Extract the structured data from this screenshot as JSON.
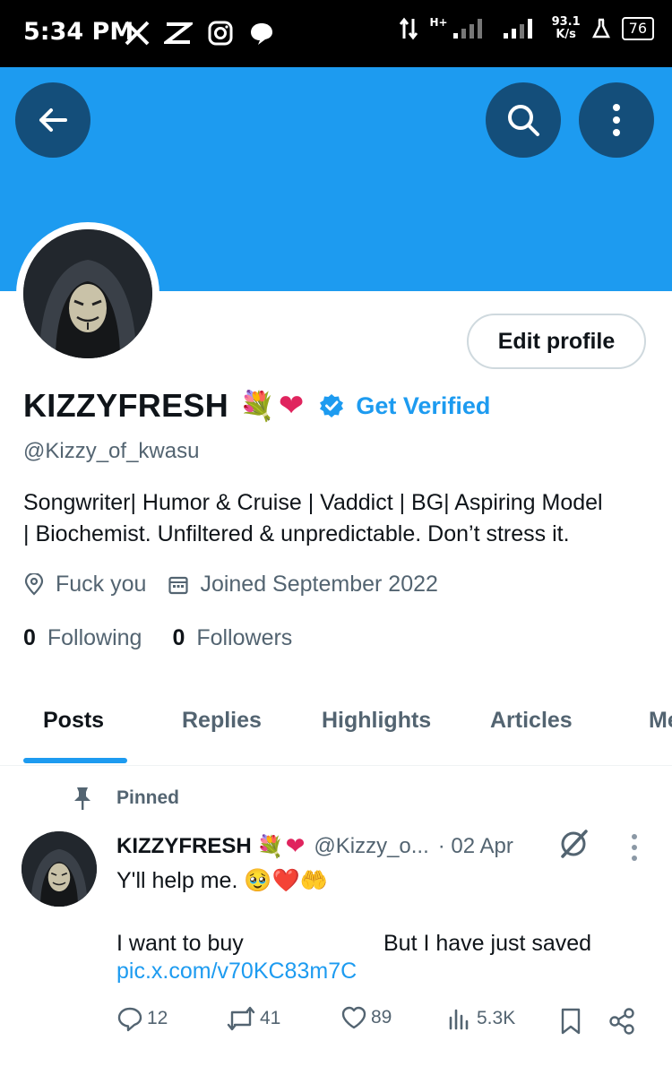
{
  "status_bar": {
    "time": "5:34 PM",
    "network_label": "H+",
    "speed_value": "93.1",
    "speed_unit": "K/s",
    "battery": "76"
  },
  "header": {
    "back_icon": "arrow-left-icon",
    "search_icon": "search-icon",
    "more_icon": "more-vertical-icon",
    "banner_color": "#1d9bf0"
  },
  "profile": {
    "edit_label": "Edit profile",
    "name": "KIZZYFRESH",
    "name_emoji_flowers": "💐",
    "name_emoji_heart": "❤",
    "verified_label": "Get Verified",
    "handle": "@Kizzy_of_kwasu",
    "bio_line1": "Songwriter| Humor & Cruise | Vaddict | BG| Aspiring Model",
    "bio_line2": "| Biochemist.  Unfiltered & unpredictable. Don’t stress it.",
    "location": "Fuck you",
    "joined": "Joined September 2022",
    "following_count": "0",
    "following_label": "Following",
    "followers_count": "0",
    "followers_label": "Followers"
  },
  "tabs": [
    {
      "label": "Posts"
    },
    {
      "label": "Replies"
    },
    {
      "label": "Highlights"
    },
    {
      "label": "Articles"
    },
    {
      "label": "Me"
    }
  ],
  "pinned_label": "Pinned",
  "tweet": {
    "name": "KIZZYFRESH",
    "name_emoji_flowers": "💐",
    "name_emoji_heart": "❤",
    "handle": "@Kizzy_o...",
    "date": "· 02 Apr",
    "line1": "Y'll help me. 🥹❤️🤲",
    "line2_left": "I want to buy",
    "line2_right": "But I have just saved",
    "link": "pic.x.com/v70KC83m7C",
    "replies": "12",
    "reposts": "41",
    "likes": "89",
    "views": "5.3K"
  },
  "colors": {
    "accent": "#1d9bf0",
    "header_button": "#144e7a",
    "secondary_text": "#536471"
  }
}
